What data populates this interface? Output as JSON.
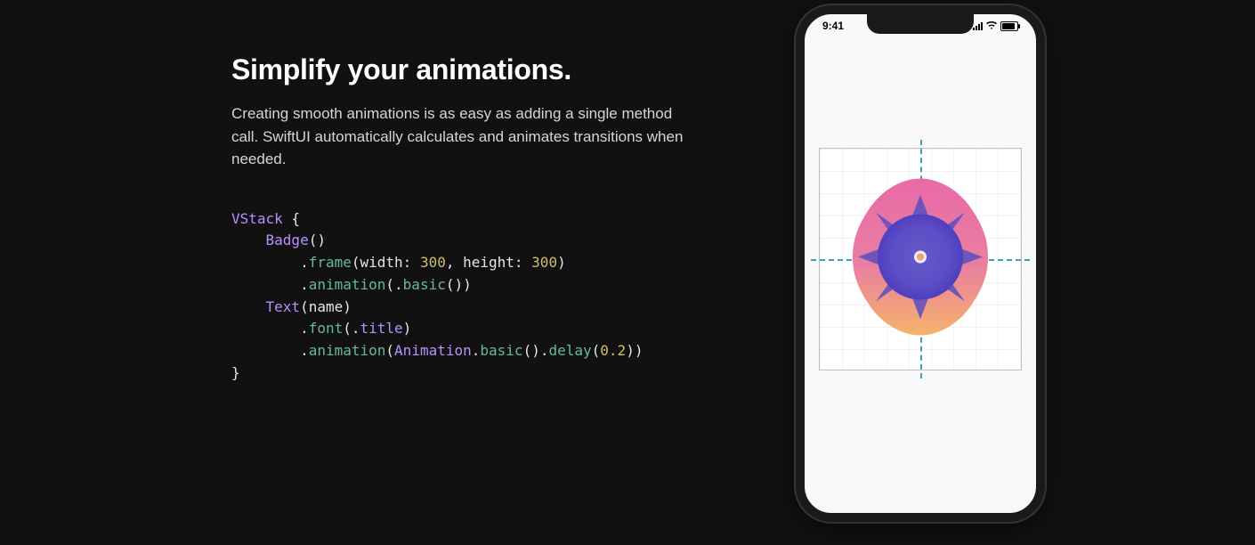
{
  "heading": "Simplify your animations.",
  "body": "Creating smooth animations is as easy as adding a single method call. SwiftUI automatically calculates and animates transitions when needed.",
  "code": {
    "tokens": [
      {
        "t": "VStack",
        "c": "tok-type"
      },
      {
        "t": " {",
        "c": "tok-id"
      },
      {
        "t": "\n",
        "c": ""
      },
      {
        "t": "    ",
        "c": ""
      },
      {
        "t": "Badge",
        "c": "tok-type"
      },
      {
        "t": "()",
        "c": "tok-id"
      },
      {
        "t": "\n",
        "c": ""
      },
      {
        "t": "        .",
        "c": "tok-id"
      },
      {
        "t": "frame",
        "c": "tok-fn"
      },
      {
        "t": "(width: ",
        "c": "tok-id"
      },
      {
        "t": "300",
        "c": "tok-num"
      },
      {
        "t": ", height: ",
        "c": "tok-id"
      },
      {
        "t": "300",
        "c": "tok-num"
      },
      {
        "t": ")",
        "c": "tok-id"
      },
      {
        "t": "\n",
        "c": ""
      },
      {
        "t": "        .",
        "c": "tok-id"
      },
      {
        "t": "animation",
        "c": "tok-fn"
      },
      {
        "t": "(.",
        "c": "tok-id"
      },
      {
        "t": "basic",
        "c": "tok-fn"
      },
      {
        "t": "())",
        "c": "tok-id"
      },
      {
        "t": "\n",
        "c": ""
      },
      {
        "t": "    ",
        "c": ""
      },
      {
        "t": "Text",
        "c": "tok-type"
      },
      {
        "t": "(name)",
        "c": "tok-id"
      },
      {
        "t": "\n",
        "c": ""
      },
      {
        "t": "        .",
        "c": "tok-id"
      },
      {
        "t": "font",
        "c": "tok-fn"
      },
      {
        "t": "(.",
        "c": "tok-id"
      },
      {
        "t": "title",
        "c": "tok-type"
      },
      {
        "t": ")",
        "c": "tok-id"
      },
      {
        "t": "\n",
        "c": ""
      },
      {
        "t": "        .",
        "c": "tok-id"
      },
      {
        "t": "animation",
        "c": "tok-fn"
      },
      {
        "t": "(",
        "c": "tok-id"
      },
      {
        "t": "Animation",
        "c": "tok-type"
      },
      {
        "t": ".",
        "c": "tok-id"
      },
      {
        "t": "basic",
        "c": "tok-fn"
      },
      {
        "t": "().",
        "c": "tok-id"
      },
      {
        "t": "delay",
        "c": "tok-fn"
      },
      {
        "t": "(",
        "c": "tok-id"
      },
      {
        "t": "0.2",
        "c": "tok-num"
      },
      {
        "t": "))",
        "c": "tok-id"
      },
      {
        "t": "\n",
        "c": ""
      },
      {
        "t": "}",
        "c": "tok-id"
      }
    ]
  },
  "phone": {
    "status_time": "9:41"
  }
}
